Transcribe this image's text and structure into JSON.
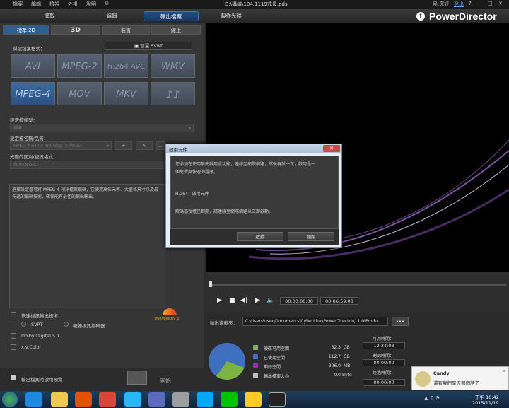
{
  "titlebar": {
    "menus": [
      "檔案",
      "編輯",
      "檢視",
      "外掛",
      "說明"
    ],
    "doc_title": "D:\\攝繪\\104.1119戒長.pds",
    "user": "民,您好",
    "logout": "登出"
  },
  "main_tabs": [
    "擷取",
    "編輯",
    "輸出檔案",
    "製作光碟"
  ],
  "brand": "PowerDirector",
  "sub_tabs": [
    "標準 2D",
    "3D",
    "裝置",
    "線上"
  ],
  "left": {
    "format_label": "擷取檔案格式：",
    "svrt_button": "智慧 SVRT",
    "formats": [
      "AVI",
      "MPEG-2",
      "H.264 AVC",
      "WMV",
      "MPEG-4",
      "MOV",
      "MKV"
    ],
    "profile_type_label": "設定檔類型：",
    "profile_type_value": "標準",
    "profile_name_label": "設定檔名稱/品質：",
    "profile_name_value": "MPEG-4 640 x 480/30p (8 Mbps)",
    "region_label": "光碟的國別/視訊格式：",
    "region_value": "台灣 (NTSC)",
    "description": "選擇設定檔可將 MPEG-4 視訊檔案編碼，它使用高位元率、大畫格尺寸以及最先進的編碼技術，確保能有最佳的編碼輸出。",
    "fast_render_label": "快速視訊輸出技術：",
    "svrt_option": "SVRT",
    "hw_option": "硬體視訊編碼器",
    "dolby": "Dolby Digital 5.1",
    "xvcolor": "x.v.Color",
    "preview_check": "輸出檔案時啟用預覽",
    "start_button": "開始",
    "truevelocity": "TrueVelocity 3"
  },
  "controls": {
    "tc_current": "00:00:00:00",
    "tc_total": "00:06:59:08"
  },
  "output": {
    "folder_label": "輸出資料夾：",
    "folder_path": "C:\\Users\\user\\Documents\\CyberLink\\PowerDirector\\11.0\\Produ",
    "more": "•••",
    "legend": [
      {
        "label": "硬碟可用空間",
        "value": "32.3",
        "unit": "GB",
        "color": "#7cb342"
      },
      {
        "label": "已使用空間",
        "value": "112.7",
        "unit": "GB",
        "color": "#3f6fbf"
      },
      {
        "label": "剩餘空間",
        "value": "306.0",
        "unit": "MB",
        "color": "#9c27b0"
      },
      {
        "label": "輸出檔案大小",
        "value": "0.0",
        "unit": "Byte",
        "color": "#bdbdbd"
      }
    ],
    "available_time_label": "可用時間：",
    "available_time": "12:34:03",
    "remaining_time_label": "剩餘時間：",
    "remaining_time": "00:00:00",
    "elapsed_time_label": "經過時間：",
    "elapsed_time": "00:00:00"
  },
  "dialog": {
    "title": "啟用元件",
    "line1": "您必須在使用前先啟用此功能，連線至網際網路，然後再試一次，啟用是一",
    "line2": "個免費與快速的程序。",
    "component": "H.264 - 啟用元件",
    "line3": "解碼器授權已到期，請連線至網際網路以立即啟動。",
    "activate": "啟動",
    "close": "關閉"
  },
  "toast": {
    "name": "Candy",
    "message": "還有我們聊天那個話子"
  },
  "clock": {
    "time": "下午 10:42",
    "date": "2015/11/19"
  }
}
